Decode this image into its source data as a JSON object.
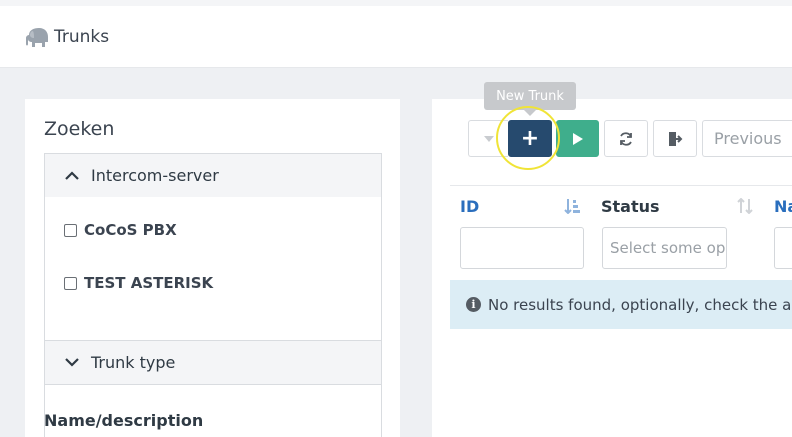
{
  "header": {
    "title": "Trunks",
    "icon": "elephant-icon"
  },
  "search": {
    "heading": "Zoeken",
    "intercom_section": {
      "label": "Intercom-server",
      "options": [
        "CoCoS PBX",
        "TEST ASTERISK"
      ]
    },
    "trunk_type_section": {
      "label": "Trunk type"
    },
    "name_description_label": "Name/description"
  },
  "toolbar": {
    "new_trunk_tooltip": "New Trunk",
    "add_label": "+",
    "previous_label": "Previous"
  },
  "table": {
    "columns": [
      "ID",
      "Status",
      "Na"
    ],
    "status_filter_placeholder": "Select some op",
    "no_results": "No results found, optionally, check the a",
    "info_icon_glyph": "i"
  },
  "colors": {
    "primary": "#264a6e",
    "success": "#3fae8c",
    "link": "#2a6ebd",
    "info_bg": "#dcedf5",
    "highlight": "#f0e437"
  }
}
